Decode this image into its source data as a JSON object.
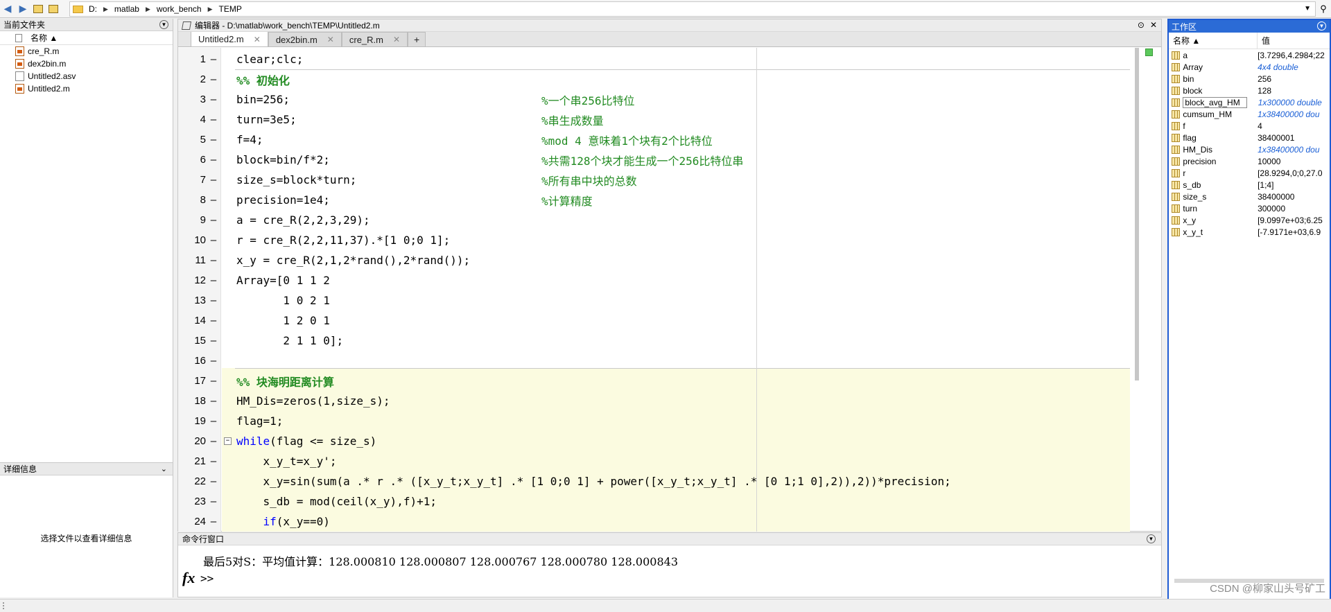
{
  "address_bar": {
    "path": [
      "D:",
      "matlab",
      "work_bench",
      "TEMP"
    ]
  },
  "current_folder": {
    "title": "当前文件夹",
    "column_name": "名称 ▲",
    "files": [
      {
        "name": "cre_R.m",
        "type": "mfile"
      },
      {
        "name": "dex2bin.m",
        "type": "mfile"
      },
      {
        "name": "Untitled2.asv",
        "type": "asv"
      },
      {
        "name": "Untitled2.m",
        "type": "mfile"
      }
    ]
  },
  "details": {
    "title": "详细信息",
    "message": "选择文件以查看详细信息"
  },
  "editor": {
    "title": "编辑器 - D:\\matlab\\work_bench\\TEMP\\Untitled2.m",
    "tabs": [
      {
        "label": "Untitled2.m",
        "active": true
      },
      {
        "label": "dex2bin.m",
        "active": false
      },
      {
        "label": "cre_R.m",
        "active": false
      }
    ],
    "add_tab": "+",
    "lines": [
      {
        "n": "1",
        "code": "clear;clc;",
        "comment": ""
      },
      {
        "n": "2",
        "code": "%% 初始化",
        "comment": "",
        "section": true
      },
      {
        "n": "3",
        "code": "bin=256;",
        "comment": "%一个串256比特位"
      },
      {
        "n": "4",
        "code": "turn=3e5;",
        "comment": "%串生成数量"
      },
      {
        "n": "5",
        "code": "f=4;",
        "comment": "%mod 4 意味着1个块有2个比特位"
      },
      {
        "n": "6",
        "code": "block=bin/f*2;",
        "comment": "%共需128个块才能生成一个256比特位串"
      },
      {
        "n": "7",
        "code": "size_s=block*turn;",
        "comment": "%所有串中块的总数"
      },
      {
        "n": "8",
        "code": "precision=1e4;",
        "comment": "%计算精度"
      },
      {
        "n": "9",
        "code": "a = cre_R(2,2,3,29);",
        "comment": ""
      },
      {
        "n": "10",
        "code": "r = cre_R(2,2,11,37).*[1 0;0 1];",
        "comment": ""
      },
      {
        "n": "11",
        "code": "x_y = cre_R(2,1,2*rand(),2*rand());",
        "comment": ""
      },
      {
        "n": "12",
        "code": "Array=[0 1 1 2",
        "comment": ""
      },
      {
        "n": "13",
        "code": "       1 0 2 1",
        "comment": ""
      },
      {
        "n": "14",
        "code": "       1 2 0 1",
        "comment": ""
      },
      {
        "n": "15",
        "code": "       2 1 1 0];",
        "comment": ""
      },
      {
        "n": "16",
        "code": "",
        "comment": ""
      },
      {
        "n": "17",
        "code": "%% 块海明距离计算",
        "comment": "",
        "section": true
      },
      {
        "n": "18",
        "code": "HM_Dis=zeros(1,size_s);",
        "comment": ""
      },
      {
        "n": "19",
        "code": "flag=1;",
        "comment": ""
      },
      {
        "n": "20",
        "kw": "while",
        "code": "(flag <= size_s)",
        "comment": ""
      },
      {
        "n": "21",
        "code": "    x_y_t=x_y';",
        "comment": ""
      },
      {
        "n": "22",
        "code": "    x_y=sin(sum(a .* r .* ([x_y_t;x_y_t] .* [1 0;0 1] + power([x_y_t;x_y_t] .* [0 1;1 0],2)),2))*precision;",
        "comment": ""
      },
      {
        "n": "23",
        "code": "    s_db = mod(ceil(x_y),f)+1;",
        "comment": ""
      },
      {
        "n": "24",
        "kw": "    if",
        "code": "(x_y==0)",
        "comment": ""
      }
    ]
  },
  "command_window": {
    "title": "命令行窗口",
    "output": "最后5对S：平均值计算：128.000810 128.000807 128.000767 128.000780 128.000843",
    "fx": "fx",
    "prompt": ">>"
  },
  "workspace": {
    "title": "工作区",
    "col_name": "名称 ▲",
    "col_value": "值",
    "vars": [
      {
        "name": "a",
        "value": "[3.7296,4.2984;22",
        "italic": false
      },
      {
        "name": "Array",
        "value": "4x4 double",
        "italic": true
      },
      {
        "name": "bin",
        "value": "256",
        "italic": false
      },
      {
        "name": "block",
        "value": "128",
        "italic": false
      },
      {
        "name": "block_avg_HM",
        "value": "1x300000 double",
        "italic": true,
        "selected": true
      },
      {
        "name": "cumsum_HM",
        "value": "1x38400000 dou",
        "italic": true
      },
      {
        "name": "f",
        "value": "4",
        "italic": false
      },
      {
        "name": "flag",
        "value": "38400001",
        "italic": false
      },
      {
        "name": "HM_Dis",
        "value": "1x38400000 dou",
        "italic": true
      },
      {
        "name": "precision",
        "value": "10000",
        "italic": false
      },
      {
        "name": "r",
        "value": "[28.9294,0;0,27.0",
        "italic": false
      },
      {
        "name": "s_db",
        "value": "[1;4]",
        "italic": false
      },
      {
        "name": "size_s",
        "value": "38400000",
        "italic": false
      },
      {
        "name": "turn",
        "value": "300000",
        "italic": false
      },
      {
        "name": "x_y",
        "value": "[9.0997e+03;6.25",
        "italic": false
      },
      {
        "name": "x_y_t",
        "value": "[-7.9171e+03,6.9",
        "italic": false
      }
    ],
    "watermark": "CSDN @柳家山头号矿工"
  }
}
